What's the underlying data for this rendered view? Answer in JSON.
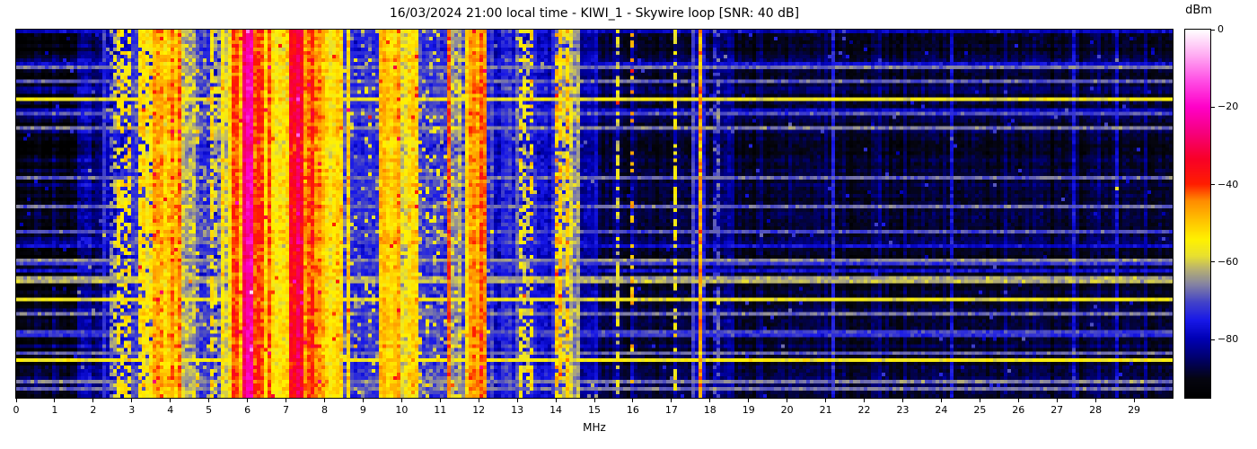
{
  "chart_data": {
    "type": "heatmap",
    "title": "16/03/2024 21:00 local time - KIWI_1 - Skywire loop [SNR: 40 dB]",
    "xlabel": "MHz",
    "x_axis": {
      "range_mhz": [
        0,
        30
      ],
      "ticks": [
        0,
        1,
        2,
        3,
        4,
        5,
        6,
        7,
        8,
        9,
        10,
        11,
        12,
        13,
        14,
        15,
        16,
        17,
        18,
        19,
        20,
        21,
        22,
        23,
        24,
        25,
        26,
        27,
        28,
        29
      ]
    },
    "y_axis": {
      "meaning": "time (no tick labels shown)"
    },
    "value_unit": "dBm",
    "value_range": [
      -95,
      0
    ],
    "colorbar": {
      "label": "dBm",
      "ticks": [
        {
          "value": 0,
          "label": "0"
        },
        {
          "value": -20,
          "label": "−20"
        },
        {
          "value": -40,
          "label": "−40"
        },
        {
          "value": -60,
          "label": "−60"
        },
        {
          "value": -80,
          "label": "−80"
        }
      ]
    },
    "colormap_stops": [
      [
        0.0,
        "#000000"
      ],
      [
        0.05,
        "#050510"
      ],
      [
        0.11,
        "#000070"
      ],
      [
        0.16,
        "#0000b4"
      ],
      [
        0.21,
        "#1818e8"
      ],
      [
        0.26,
        "#4444c8"
      ],
      [
        0.31,
        "#8886a0"
      ],
      [
        0.35,
        "#b8b270"
      ],
      [
        0.385,
        "#e8e030"
      ],
      [
        0.43,
        "#fff200"
      ],
      [
        0.48,
        "#ffc400"
      ],
      [
        0.535,
        "#ff8c00"
      ],
      [
        0.58,
        "#ff1e00"
      ],
      [
        0.65,
        "#f80028"
      ],
      [
        0.72,
        "#f6007c"
      ],
      [
        0.79,
        "#ff00c8"
      ],
      [
        0.86,
        "#ff4ce4"
      ],
      [
        0.93,
        "#ffaaf2"
      ],
      [
        1.0,
        "#ffffff"
      ]
    ],
    "grid": {
      "cols": 322,
      "rows": 103
    },
    "seed": 7,
    "background": {
      "level": -88,
      "var": 2.4
    },
    "bands": [
      {
        "f0": 0.0,
        "f1": 0.45,
        "level": -91.5,
        "var": 1.8,
        "rowvar": 2.6
      },
      {
        "f0": 0.45,
        "f1": 1.55,
        "level": -89.5,
        "var": 2.6,
        "rowvar": 2.6
      },
      {
        "f0": 1.55,
        "f1": 2.02,
        "level": -85.0,
        "var": 3.5,
        "rowvar": 2.0
      },
      {
        "f0": 2.02,
        "f1": 2.07,
        "level": -66.0,
        "var": 1.5
      },
      {
        "f0": 2.07,
        "f1": 2.2,
        "level": -83.0,
        "var": 3.0
      },
      {
        "f0": 2.2,
        "f1": 2.45,
        "level": -76.0,
        "var": 4.0
      },
      {
        "f0": 2.45,
        "f1": 2.95,
        "level": -59.0,
        "var": 5.0,
        "duty": 0.55,
        "off": -77
      },
      {
        "f0": 2.95,
        "f1": 3.15,
        "level": -73.0,
        "var": 5.0
      },
      {
        "f0": 3.15,
        "f1": 3.55,
        "level": -56.0,
        "var": 5.0,
        "duty": 0.85,
        "off": -74
      },
      {
        "f0": 3.55,
        "f1": 3.97,
        "level": -50.0,
        "var": 6.0
      },
      {
        "f0": 3.97,
        "f1": 4.04,
        "level": -28.0,
        "var": 4.0
      },
      {
        "f0": 4.04,
        "f1": 4.32,
        "level": -46.0,
        "var": 6.0
      },
      {
        "f0": 4.32,
        "f1": 4.62,
        "level": -60.0,
        "var": 7.0
      },
      {
        "f0": 4.62,
        "f1": 5.06,
        "level": -60.0,
        "var": 5.0,
        "duty": 0.15,
        "off": -71
      },
      {
        "f0": 5.06,
        "f1": 5.28,
        "level": -60.0,
        "var": 6.0,
        "duty": 0.7,
        "off": -74
      },
      {
        "f0": 5.28,
        "f1": 5.58,
        "level": -55.0,
        "var": 6.0
      },
      {
        "f0": 5.58,
        "f1": 5.88,
        "level": -46.0,
        "var": 5.0
      },
      {
        "f0": 5.88,
        "f1": 6.17,
        "level": -27.0,
        "var": 5.0
      },
      {
        "f0": 5.95,
        "f1": 6.1,
        "level": -23.0,
        "var": 4.0
      },
      {
        "f0": 6.17,
        "f1": 6.47,
        "level": -41.0,
        "var": 5.0
      },
      {
        "f0": 6.47,
        "f1": 6.85,
        "level": -50.0,
        "var": 5.0
      },
      {
        "f0": 6.85,
        "f1": 7.06,
        "level": -57.0,
        "var": 7.0
      },
      {
        "f0": 7.06,
        "f1": 7.24,
        "level": -41.0,
        "var": 5.0
      },
      {
        "f0": 7.24,
        "f1": 7.48,
        "level": -28.0,
        "var": 5.0
      },
      {
        "f0": 7.48,
        "f1": 7.84,
        "level": -43.0,
        "var": 5.0
      },
      {
        "f0": 7.84,
        "f1": 8.34,
        "level": -51.0,
        "var": 5.0
      },
      {
        "f0": 8.34,
        "f1": 8.64,
        "level": -59.0,
        "var": 7.0
      },
      {
        "f0": 8.64,
        "f1": 9.38,
        "level": -61.0,
        "var": 4.0,
        "duty": 0.1,
        "off": -73
      },
      {
        "f0": 9.38,
        "f1": 9.94,
        "level": -47.0,
        "var": 5.0
      },
      {
        "f0": 9.94,
        "f1": 10.44,
        "level": -56.0,
        "var": 6.0
      },
      {
        "f0": 10.44,
        "f1": 11.15,
        "level": -60.0,
        "var": 5.0,
        "duty": 0.12,
        "off": -72
      },
      {
        "f0": 11.16,
        "f1": 11.23,
        "level": -42.0,
        "var": 5.0
      },
      {
        "f0": 11.23,
        "f1": 11.64,
        "level": -65.0,
        "var": 7.0
      },
      {
        "f0": 11.64,
        "f1": 12.24,
        "level": -47.0,
        "var": 5.0
      },
      {
        "f0": 11.9,
        "f1": 12.14,
        "level": -43.0,
        "var": 5.0
      },
      {
        "f0": 12.24,
        "f1": 13.0,
        "level": -74.0,
        "var": 4.0
      },
      {
        "f0": 13.0,
        "f1": 13.44,
        "level": -60.0,
        "var": 5.0,
        "duty": 0.5,
        "off": -76
      },
      {
        "f0": 13.44,
        "f1": 13.98,
        "level": -77.0,
        "var": 4.0
      },
      {
        "f0": 13.98,
        "f1": 14.36,
        "level": -56.0,
        "var": 6.0,
        "duty": 0.8,
        "off": -72
      },
      {
        "f0": 14.04,
        "f1": 14.11,
        "level": -45.0,
        "var": 4.0,
        "t0": 0.04,
        "t1": 0.24,
        "off": -58
      },
      {
        "f0": 14.36,
        "f1": 14.6,
        "level": -62.0,
        "var": 6.0
      },
      {
        "f0": 14.6,
        "f1": 15.04,
        "level": -80.0,
        "var": 3.0
      },
      {
        "f0": 15.04,
        "f1": 15.08,
        "level": -75.0,
        "var": 2.0
      },
      {
        "f0": 15.17,
        "f1": 15.21,
        "level": -76.0,
        "var": 2.0
      },
      {
        "f0": 15.59,
        "f1": 15.66,
        "level": -57.0,
        "var": 4.0,
        "duty": 0.55,
        "off": -80
      },
      {
        "f0": 15.7,
        "f1": 15.75,
        "level": -68.0,
        "var": 2.0
      },
      {
        "f0": 15.94,
        "f1": 16.05,
        "level": -50.0,
        "var": 5.0,
        "duty": 0.28,
        "off": -82
      },
      {
        "f0": 16.3,
        "f1": 16.34,
        "level": -79.0,
        "var": 2.5
      },
      {
        "f0": 17.08,
        "f1": 17.16,
        "level": -58.0,
        "var": 4.0,
        "duty": 0.5,
        "off": -83
      },
      {
        "f0": 17.3,
        "f1": 17.34,
        "level": -78.0,
        "var": 2.5
      },
      {
        "f0": 17.5,
        "f1": 17.9,
        "level": -76.0,
        "var": 3.0
      },
      {
        "f0": 17.58,
        "f1": 17.64,
        "level": -41.0,
        "var": 3.0
      },
      {
        "f0": 17.66,
        "f1": 17.8,
        "level": -50.0,
        "var": 6.0
      },
      {
        "f0": 18.1,
        "f1": 18.24,
        "level": -71.0,
        "var": 3.0,
        "duty": 0.45,
        "off": -82
      },
      {
        "f0": 18.28,
        "f1": 18.6,
        "level": -83.0,
        "var": 3.0
      },
      {
        "f0": 19.16,
        "f1": 19.2,
        "level": -82.0,
        "var": 2.5
      },
      {
        "f0": 21.18,
        "f1": 21.24,
        "level": -77.0,
        "var": 3.0
      },
      {
        "f0": 22.4,
        "f1": 22.44,
        "level": -83.0,
        "var": 2.5
      },
      {
        "f0": 24.22,
        "f1": 24.28,
        "level": -78.0,
        "var": 3.0
      },
      {
        "f0": 25.8,
        "f1": 25.85,
        "level": -82.0,
        "var": 2.5
      },
      {
        "f0": 27.38,
        "f1": 27.44,
        "level": -77.0,
        "var": 3.0
      },
      {
        "f0": 28.08,
        "f1": 28.13,
        "level": -81.0,
        "var": 2.5
      },
      {
        "f0": 28.52,
        "f1": 28.58,
        "level": -79.0,
        "var": 3.0
      },
      {
        "f0": 29.28,
        "f1": 29.33,
        "level": -82.0,
        "var": 2.5
      }
    ],
    "row_streaks": {
      "probability": 0.13,
      "level_min": -80,
      "level_max": -63,
      "strong": [
        {
          "t": 0.19,
          "level": -57
        },
        {
          "t": 0.265,
          "level": -66
        },
        {
          "t": 0.4,
          "level": -68
        },
        {
          "t": 0.545,
          "level": -70
        },
        {
          "t": 0.625,
          "level": -65
        },
        {
          "t": 0.685,
          "level": -62
        },
        {
          "t": 0.735,
          "level": -57
        },
        {
          "t": 0.775,
          "level": -67
        },
        {
          "t": 0.905,
          "level": -56
        },
        {
          "t": 0.96,
          "level": -66
        }
      ]
    }
  }
}
